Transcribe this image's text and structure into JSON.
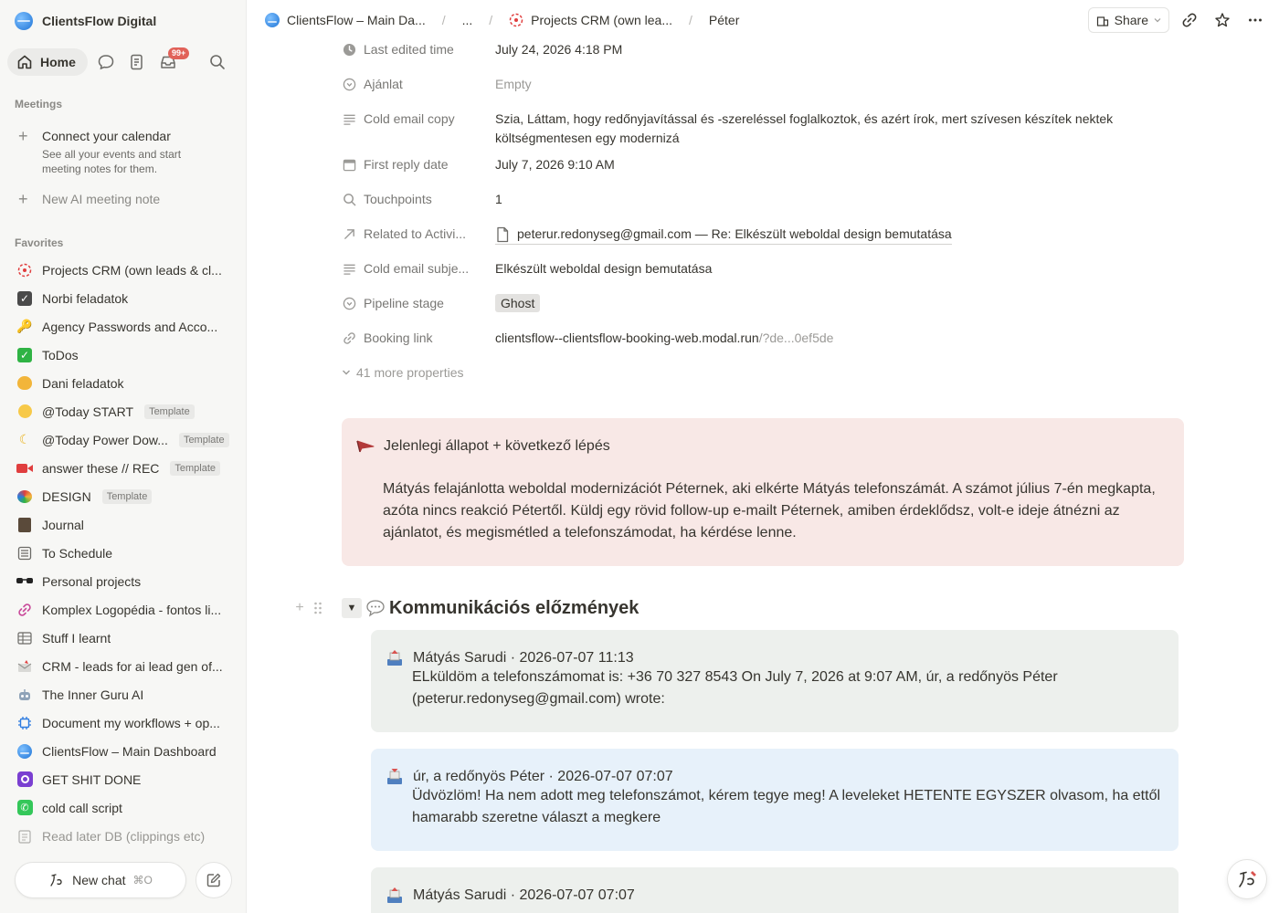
{
  "workspace": {
    "name": "ClientsFlow Digital"
  },
  "nav": {
    "home_label": "Home",
    "inbox_badge": "99+"
  },
  "meetings": {
    "section_title": "Meetings",
    "connect_title": "Connect your calendar",
    "connect_sub": "See all your events and start meeting notes for them.",
    "new_ai_note": "New AI meeting note"
  },
  "favorites": {
    "section_title": "Favorites",
    "items": [
      {
        "label": "Projects CRM (own leads & cl...",
        "icon": "crm-icon",
        "template": ""
      },
      {
        "label": "Norbi feladatok",
        "icon": "check-box-icon",
        "template": ""
      },
      {
        "label": "Agency Passwords and Acco...",
        "icon": "key-icon",
        "template": ""
      },
      {
        "label": "ToDos",
        "icon": "green-check-icon",
        "template": ""
      },
      {
        "label": "Dani feladatok",
        "icon": "cat-icon",
        "template": ""
      },
      {
        "label": "@Today START",
        "icon": "smile-icon",
        "template": "Template"
      },
      {
        "label": "@Today Power Dow...",
        "icon": "moon-icon",
        "template": "Template"
      },
      {
        "label": "answer these // REC",
        "icon": "video-icon",
        "template": "Template"
      },
      {
        "label": "DESIGN",
        "icon": "palette-icon",
        "template": "Template"
      },
      {
        "label": "Journal",
        "icon": "journal-icon",
        "template": ""
      },
      {
        "label": "To Schedule",
        "icon": "calendar-list-icon",
        "template": ""
      },
      {
        "label": "Personal projects",
        "icon": "sunglasses-icon",
        "template": ""
      },
      {
        "label": "Komplex Logopédia - fontos li...",
        "icon": "link-icon",
        "template": ""
      },
      {
        "label": "Stuff I learnt",
        "icon": "table-icon",
        "template": ""
      },
      {
        "label": "CRM - leads for ai lead gen of...",
        "icon": "envelope-icon",
        "template": ""
      },
      {
        "label": "The Inner Guru AI",
        "icon": "robot-icon",
        "template": ""
      },
      {
        "label": "Document my workflows + op...",
        "icon": "chip-icon",
        "template": ""
      },
      {
        "label": "ClientsFlow – Main Dashboard",
        "icon": "globe-icon",
        "template": ""
      },
      {
        "label": "GET SHIT DONE",
        "icon": "purple-eye-icon",
        "template": ""
      },
      {
        "label": "cold call script",
        "icon": "phone-icon",
        "template": ""
      },
      {
        "label": "Read later DB (clippings etc)",
        "icon": "clipboard-icon",
        "template": ""
      }
    ]
  },
  "new_chat": {
    "label": "New chat",
    "shortcut": "⌘O"
  },
  "breadcrumb": {
    "item1": "ClientsFlow – Main Da...",
    "item2": "...",
    "item3": "Projects CRM (own lea...",
    "item4": "Péter"
  },
  "topbar": {
    "share_label": "Share"
  },
  "properties": [
    {
      "name": "Last edited time",
      "value": "July 24, 2026 4:18 PM",
      "icon": "clock-icon"
    },
    {
      "name": "Ajánlat",
      "value": "Empty",
      "icon": "select-icon"
    },
    {
      "name": "Cold email copy",
      "value": "Szia, Láttam, hogy redőnyjavítással és -szereléssel foglalkoztok, és azért írok, mert szívesen készítek nektek költségmentesen egy modernizá",
      "icon": "text-icon"
    },
    {
      "name": "First reply date",
      "value": "July 7, 2026 9:10 AM",
      "icon": "calendar-icon"
    },
    {
      "name": "Touchpoints",
      "value": "1",
      "icon": "search-icon"
    },
    {
      "name": "Related to Activi...",
      "value": "peterur.redonyseg@gmail.com — Re: Elkészült weboldal design bemutatása",
      "icon": "arrow-icon"
    },
    {
      "name": "Cold email subje...",
      "value": "Elkészült weboldal design bemutatása",
      "icon": "text-icon"
    },
    {
      "name": "Pipeline stage",
      "value": "Ghost",
      "icon": "select-icon"
    },
    {
      "name": "Booking link",
      "value": "clientsflow--clientsflow-booking-web.modal.run",
      "value_dim": "/?de...0ef5de",
      "icon": "link-icon"
    }
  ],
  "more_properties": "41 more properties",
  "callout": {
    "title": "Jelenlegi állapot + következő lépés",
    "body": "Mátyás felajánlotta weboldal modernizációt Péternek, aki elkérte Mátyás telefonszámát. A számot július 7-én megkapta, azóta nincs reakció Pétertől. Küldj egy rövid follow-up e-mailt Péternek, amiben érdeklődsz, volt-e ideje átnézni az ajánlatot, és megismétled a telefonszámodat, ha kérdése lenne."
  },
  "section_heading": "Kommunikációs előzmények",
  "messages": [
    {
      "header": "Mátyás Sarudi · 2026-07-07 11:13",
      "body": "ELküldöm a telefonszámomat is: +36 70 327 8543 On July 7, 2026 at 9:07 AM, úr, a redőnyös Péter (peterur.redonyseg@gmail.com) wrote:"
    },
    {
      "header": "úr, a redőnyös Péter · 2026-07-07 07:07",
      "body": "Üdvözlöm! Ha nem adott meg telefonszámot, kérem tegye meg! A leveleket HETENTE EGYSZER olvasom, ha ettől hamarabb szeretne választ a megkere"
    },
    {
      "header": "Mátyás Sarudi · 2026-07-07 07:07",
      "body": ""
    }
  ],
  "colors": {
    "callout_bg": "#f8e8e6",
    "msg_green": "#edf0ed",
    "msg_blue": "#e7f1fa",
    "badge": "#e16259"
  }
}
